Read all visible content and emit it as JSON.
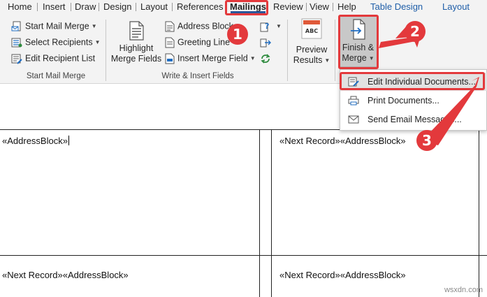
{
  "tabs": [
    {
      "label": "Home"
    },
    {
      "label": "Insert"
    },
    {
      "label": "Draw"
    },
    {
      "label": "Design"
    },
    {
      "label": "Layout"
    },
    {
      "label": "References"
    },
    {
      "label": "Mailings"
    },
    {
      "label": "Review"
    },
    {
      "label": "View"
    },
    {
      "label": "Help"
    },
    {
      "label": "Table Design"
    },
    {
      "label": "Layout"
    }
  ],
  "ribbon": {
    "start_group": {
      "label": "Start Mail Merge",
      "start_mail_merge": "Start Mail Merge",
      "select_recipients": "Select Recipients",
      "edit_recipient_list": "Edit Recipient List"
    },
    "write_group": {
      "label": "Write & Insert Fields",
      "highlight_line1": "Highlight",
      "highlight_line2": "Merge Fields",
      "address_block": "Address Block",
      "greeting_line": "Greeting Line",
      "insert_merge_field": "Insert Merge Field"
    },
    "preview": {
      "icon_text": "ABC",
      "line1": "Preview",
      "line2": "Results"
    },
    "finish": {
      "line1": "Finish &",
      "line2": "Merge"
    }
  },
  "menu": {
    "items": [
      {
        "label": "Edit Individual Documents..."
      },
      {
        "label": "Print Documents..."
      },
      {
        "label": "Send Email Messages..."
      }
    ]
  },
  "document": {
    "cell_1": "«AddressBlock»",
    "cell_2": "«Next Record»«AddressBlock»",
    "cell_3": "«Next Record»«AddressBlock»",
    "cell_4": "«Next Record»«AddressBlock»"
  },
  "annotations": {
    "badge_1": "1",
    "badge_2": "2",
    "badge_3": "3",
    "accent": "#e3393c"
  },
  "watermark": "wsxdn.com"
}
